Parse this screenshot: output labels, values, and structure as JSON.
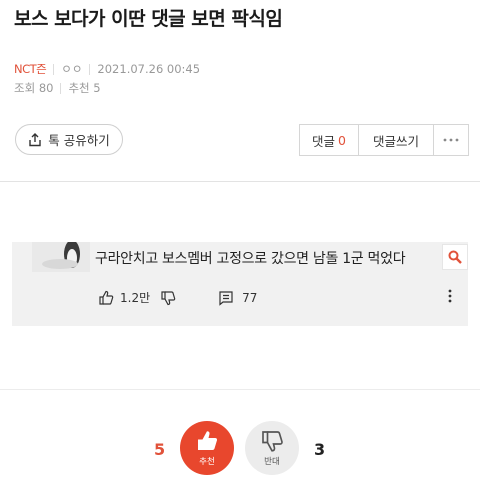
{
  "post": {
    "title": "보스 보다가 이딴 댓글 보면 팍식임",
    "board": "NCT즌",
    "author": "ㅇㅇ",
    "date": "2021.07.26 00:45",
    "views": "조회 80",
    "recommend": "추천 5"
  },
  "share": {
    "label": "톡 공유하기"
  },
  "actions": {
    "comments_label": "댓글",
    "comments_count": "0",
    "write_label": "댓글쓰기"
  },
  "embed": {
    "comment": "구라안치고  보스멤버 고정으로 갔으면 남돌 1군 먹었다",
    "likes": "1.2만",
    "replies": "77"
  },
  "vote": {
    "up_count": "5",
    "up_label": "추천",
    "down_count": "3",
    "down_label": "반대"
  },
  "colors": {
    "accent": "#e8472d"
  }
}
